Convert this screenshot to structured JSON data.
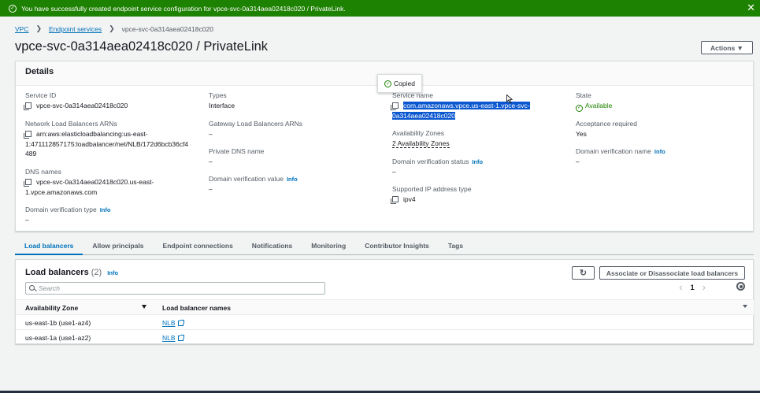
{
  "flash": {
    "message": "You have successfully created endpoint service configuration for vpce-svc-0a314aea02418c020 / PrivateLink.",
    "close": "✕"
  },
  "breadcrumb": {
    "items": [
      "VPC",
      "Endpoint services"
    ],
    "current": "vpce-svc-0a314aea02418c020"
  },
  "page": {
    "title": "vpce-svc-0a314aea02418c020 / PrivateLink",
    "actions_label": "Actions ▼"
  },
  "details": {
    "heading": "Details",
    "service_id": {
      "label": "Service ID",
      "value": "vpce-svc-0a314aea02418c020"
    },
    "nlb_arns": {
      "label": "Network Load Balancers ARNs",
      "value_line1": "arn:aws:elasticloadbalancing:us-east-",
      "value_line2": "1:471112857175:loadbalancer/net/NLB/172d6bcb36cf4",
      "value_line3": "489"
    },
    "dns_names": {
      "label": "DNS names",
      "value_line1": "vpce-svc-0a314aea02418c020.us-east-",
      "value_line2": "1.vpce.amazonaws.com"
    },
    "domain_verification_type": {
      "label": "Domain verification type",
      "info": "Info",
      "value": "–"
    },
    "types": {
      "label": "Types",
      "value": "Interface"
    },
    "gwlb_arns": {
      "label": "Gateway Load Balancers ARNs",
      "value": "–"
    },
    "private_dns": {
      "label": "Private DNS name",
      "value": "–"
    },
    "domain_verification_value": {
      "label": "Domain verification value",
      "info": "Info",
      "value": "–"
    },
    "service_name": {
      "label": "Service name",
      "value_line1": "com.amazonaws.vpce.us-east-1.vpce-svc-",
      "value_line2": "0a314aea02418c020"
    },
    "availability_zones": {
      "label": "Availability Zones",
      "value": "2 Availability Zones"
    },
    "domain_verification_status": {
      "label": "Domain verification status",
      "info": "Info",
      "value": "–"
    },
    "supported_ip": {
      "label": "Supported IP address type",
      "value": "ipv4"
    },
    "state": {
      "label": "State",
      "value": "Available"
    },
    "acceptance": {
      "label": "Acceptance required",
      "value": "Yes"
    },
    "domain_verification_name": {
      "label": "Domain verification name",
      "info": "Info",
      "value": "–"
    }
  },
  "popover": {
    "text": "Copied"
  },
  "tabs": [
    "Load balancers",
    "Allow principals",
    "Endpoint connections",
    "Notifications",
    "Monitoring",
    "Contributor Insights",
    "Tags"
  ],
  "load_balancers": {
    "title": "Load balancers",
    "count": "(2)",
    "info": "Info",
    "refresh_icon": "refresh-icon",
    "associate_label": "Associate or Disassociate load balancers",
    "search_placeholder": "Search",
    "page": "1",
    "prev": "‹",
    "next": "›",
    "columns": [
      "Availability Zone",
      "Load balancer names"
    ],
    "rows": [
      {
        "az": "us-east-1b (use1-az4)",
        "name": "NLB"
      },
      {
        "az": "us-east-1a (use1-az2)",
        "name": "NLB"
      }
    ]
  },
  "colors": {
    "success": "#1d8102",
    "link": "#0073bb",
    "selection": "#0b57d0"
  }
}
